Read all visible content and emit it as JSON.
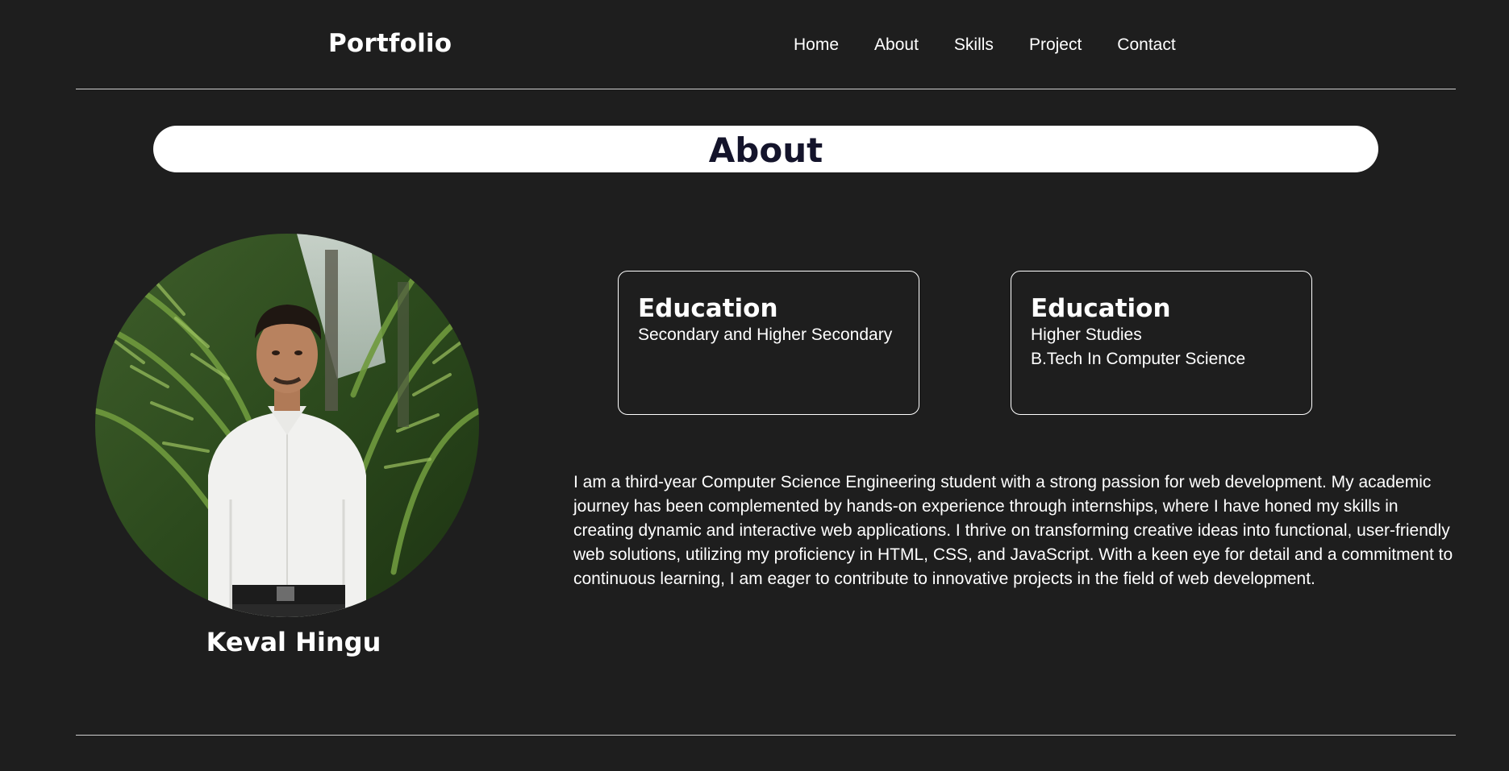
{
  "nav": {
    "brand": "Portfolio",
    "links": [
      "Home",
      "About",
      "Skills",
      "Project",
      "Contact"
    ]
  },
  "about": {
    "title": "About",
    "name": "Keval Hingu",
    "cards": [
      {
        "title": "Education",
        "lines": [
          "Secondary and Higher Secondary"
        ]
      },
      {
        "title": "Education",
        "lines": [
          "Higher Studies",
          "B.Tech In Computer Science"
        ]
      }
    ],
    "bio": "I am a third-year Computer Science Engineering student with a strong passion for web development. My academic journey has been complemented by hands-on experience through internships, where I have honed my skills in creating dynamic and interactive web applications. I thrive on transforming creative ideas into functional, user-friendly web solutions, utilizing my proficiency in HTML, CSS, and JavaScript. With a keen eye for detail and a commitment to continuous learning, I am eager to contribute to innovative projects in the field of web development."
  },
  "colors": {
    "background": "#1e1e1e",
    "text": "#ffffff",
    "title_text": "#14142b",
    "divider": "#cfcfcf"
  }
}
